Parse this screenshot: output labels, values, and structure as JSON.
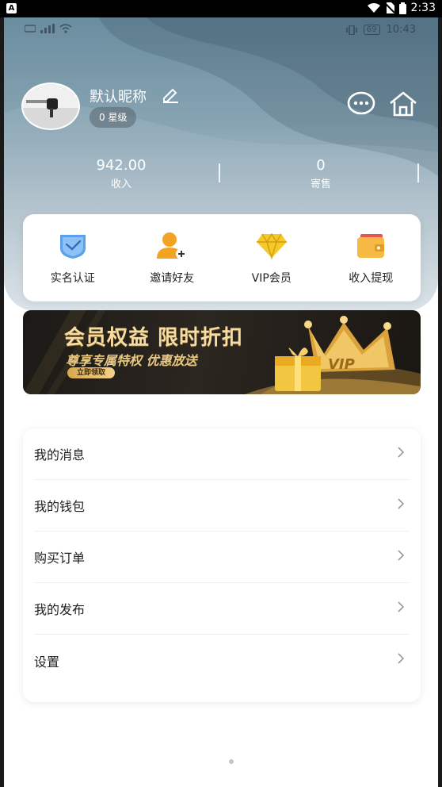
{
  "system_status": {
    "time": "2:33",
    "notification_icon": "A"
  },
  "inner_status": {
    "time": "10:43",
    "battery": "69"
  },
  "profile": {
    "nickname": "默认昵称",
    "level": "0 星级"
  },
  "stats": [
    {
      "value": "942.00",
      "label": "收入"
    },
    {
      "value": "0",
      "label": "寄售"
    }
  ],
  "quick_actions": [
    {
      "label": "实名认证",
      "icon": "shield-check-icon"
    },
    {
      "label": "邀请好友",
      "icon": "add-user-icon"
    },
    {
      "label": "VIP会员",
      "icon": "diamond-icon"
    },
    {
      "label": "收入提现",
      "icon": "wallet-icon"
    }
  ],
  "banner": {
    "title": "会员权益 限时折扣",
    "subtitle": "尊享专属特权 优惠放送",
    "cta": "立即领取",
    "badge": "VIP"
  },
  "menu": [
    {
      "label": "我的消息"
    },
    {
      "label": "我的钱包"
    },
    {
      "label": "购买订单"
    },
    {
      "label": "我的发布"
    },
    {
      "label": "设置"
    }
  ],
  "colors": {
    "header_top": "#6a8d9f",
    "header_bottom": "#d8e1e6",
    "gold": "#f6dca0",
    "icon_blue": "#5aa0ea",
    "icon_orange": "#f3a322"
  }
}
